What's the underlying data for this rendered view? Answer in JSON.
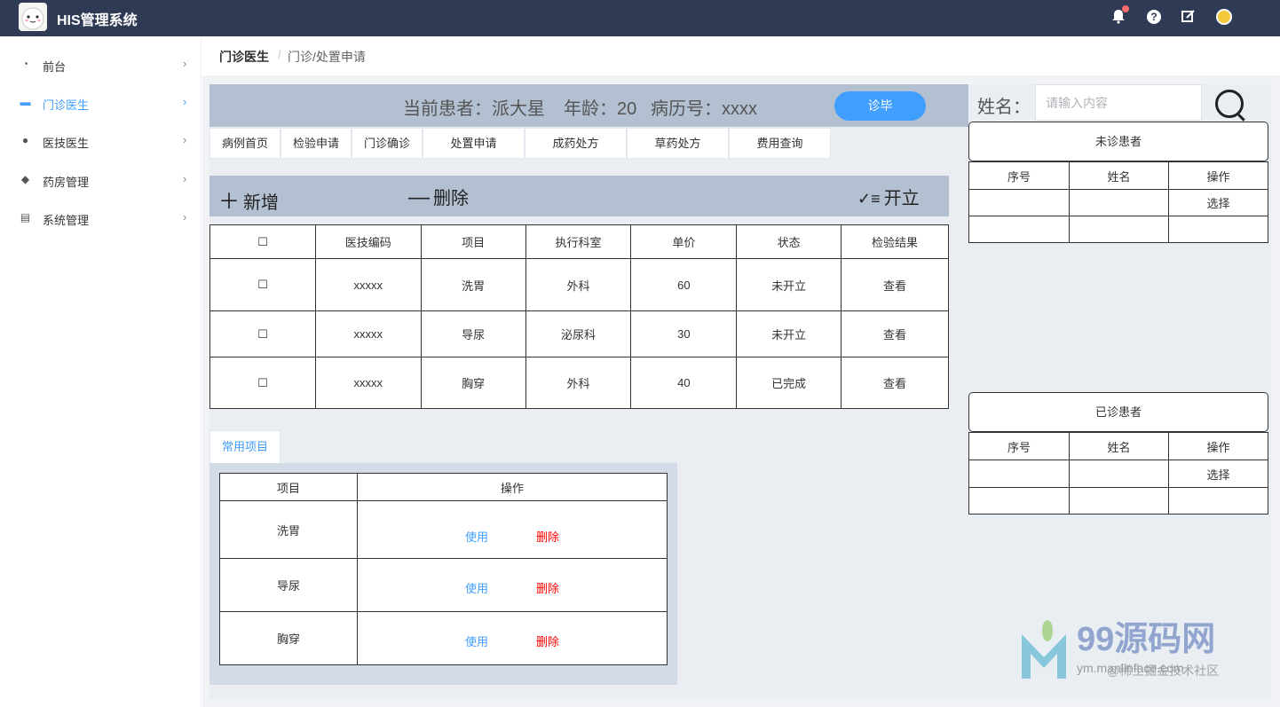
{
  "app": {
    "title": "HIS管理系统"
  },
  "sidebar": {
    "items": [
      {
        "label": "前台",
        "icon": "dashboard-icon",
        "active": false
      },
      {
        "label": "门诊医生",
        "icon": "briefcase-icon",
        "active": true
      },
      {
        "label": "医技医生",
        "icon": "users-icon",
        "active": false
      },
      {
        "label": "药房管理",
        "icon": "box-icon",
        "active": false
      },
      {
        "label": "系统管理",
        "icon": "document-icon",
        "active": false
      }
    ]
  },
  "breadcrumb": {
    "root": "门诊医生",
    "current": "门诊/处置申请"
  },
  "patient": {
    "label": "当前患者：派大星",
    "age": "年龄：20",
    "record": "病历号：xxxx",
    "finish_button": "诊毕"
  },
  "tabs": [
    "病例首页",
    "检验申请",
    "门诊确诊",
    "处置申请",
    "成药处方",
    "草药处方",
    "费用查询"
  ],
  "toolbar": {
    "add": "新增",
    "delete": "删除",
    "issue": "开立"
  },
  "exam_table": {
    "headers": [
      "☐",
      "医技编码",
      "项目",
      "执行科室",
      "单价",
      "状态",
      "检验结果"
    ],
    "rows": [
      {
        "check": "☐",
        "code": "xxxxx",
        "item": "洗胃",
        "dept": "外科",
        "price": "60",
        "status": "未开立",
        "result": "查看"
      },
      {
        "check": "☐",
        "code": "xxxxx",
        "item": "导尿",
        "dept": "泌尿科",
        "price": "30",
        "status": "未开立",
        "result": "查看"
      },
      {
        "check": "☐",
        "code": "xxxxx",
        "item": "胸穿",
        "dept": "外科",
        "price": "40",
        "status": "已完成",
        "result": "查看"
      }
    ]
  },
  "common": {
    "tab": "常用项目",
    "headers": [
      "项目",
      "操作"
    ],
    "rows": [
      {
        "item": "洗胃",
        "use": "使用",
        "remove": "删除"
      },
      {
        "item": "导尿",
        "use": "使用",
        "remove": "删除"
      },
      {
        "item": "胸穿",
        "use": "使用",
        "remove": "删除"
      }
    ]
  },
  "search": {
    "label": "姓名：",
    "placeholder": "请输入内容"
  },
  "waiting": {
    "title": "未诊患者",
    "headers": [
      "序号",
      "姓名",
      "操作"
    ],
    "rows": [
      {
        "no": "",
        "name": "",
        "action": "选择"
      },
      {
        "no": "",
        "name": "",
        "action": ""
      }
    ]
  },
  "done": {
    "title": "已诊患者",
    "headers": [
      "序号",
      "姓名",
      "操作"
    ],
    "rows": [
      {
        "no": "",
        "name": "",
        "action": "选择"
      },
      {
        "no": "",
        "name": "",
        "action": ""
      }
    ]
  },
  "watermark": {
    "brand": "99源码网",
    "site": "ym.manlinface.com",
    "credit": "@稀土掘金技术社区"
  },
  "colors": {
    "topbar": "#2f3a55",
    "accent": "#409eff",
    "bar": "#b3c0d1",
    "danger": "#ff0000"
  }
}
